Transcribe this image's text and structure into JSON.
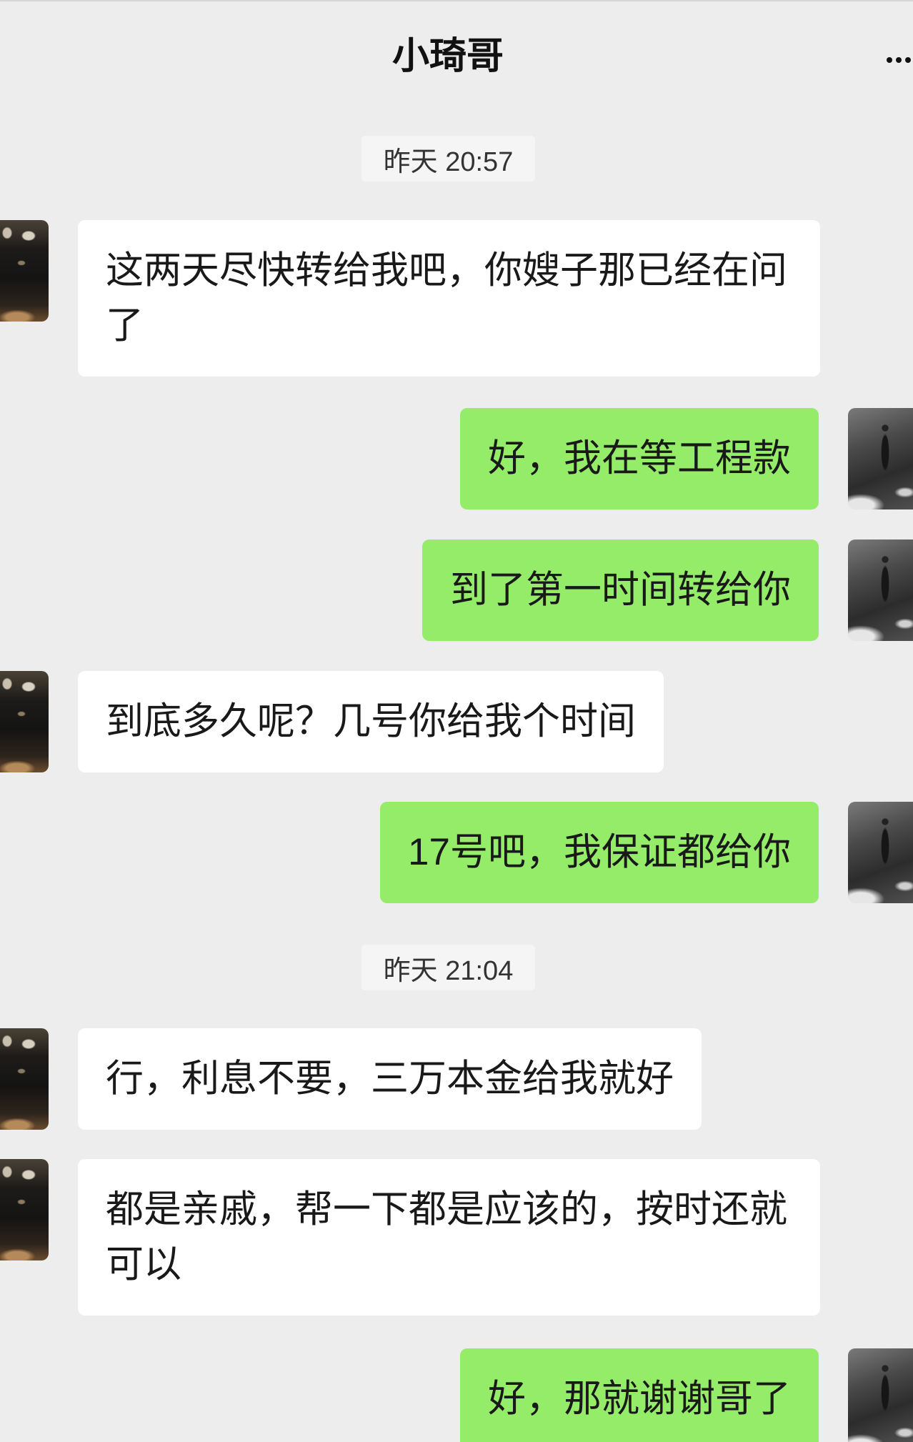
{
  "header": {
    "title": "小琦哥",
    "more_icon": "more-icon"
  },
  "colors": {
    "background": "#ededed",
    "self_bubble": "#95ec69",
    "other_bubble": "#ffffff",
    "timestamp_box": "#f5f5f5"
  },
  "avatars": {
    "contact": "contact-avatar",
    "self": "self-avatar"
  },
  "chat": {
    "timestamps": [
      "昨天 20:57",
      "昨天 21:04"
    ],
    "messages": [
      {
        "from_self": false,
        "text": "这两天尽快转给我吧，你嫂子那已经在问了"
      },
      {
        "from_self": true,
        "text": "好，我在等工程款"
      },
      {
        "from_self": true,
        "text": "到了第一时间转给你"
      },
      {
        "from_self": false,
        "text": "到底多久呢？几号你给我个时间"
      },
      {
        "from_self": true,
        "text": "17号吧，我保证都给你"
      },
      {
        "from_self": false,
        "text": "行，利息不要，三万本金给我就好"
      },
      {
        "from_self": false,
        "text": "都是亲戚，帮一下都是应该的，按时还就可以"
      },
      {
        "from_self": true,
        "text": "好，那就谢谢哥了"
      }
    ]
  }
}
